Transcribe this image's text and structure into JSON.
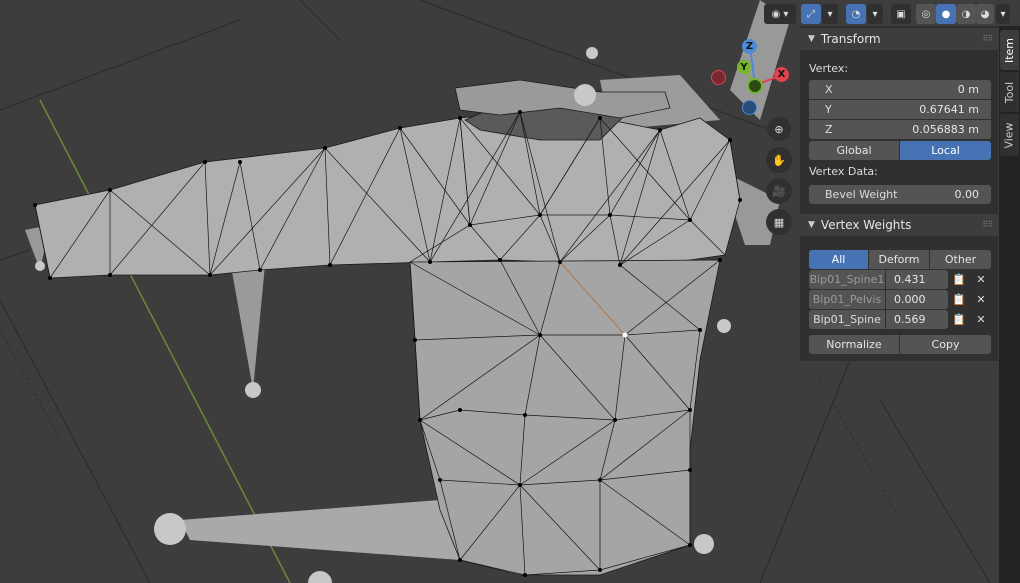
{
  "header": {
    "icons": [
      "eye-icon",
      "gizmo-icon",
      "overlay-icon",
      "xray-icon",
      "wireframe-icon",
      "solid-icon",
      "material-icon",
      "rendered-icon"
    ]
  },
  "gizmo": {
    "z": "Z",
    "y": "Y",
    "x": "X"
  },
  "transform": {
    "title": "Transform",
    "vertex_label": "Vertex:",
    "x_label": "X",
    "x_value": "0 m",
    "y_label": "Y",
    "y_value": "0.67641 m",
    "z_label": "Z",
    "z_value": "0.056883 m",
    "global": "Global",
    "local": "Local",
    "vertex_data_label": "Vertex Data:",
    "bevel_label": "Bevel Weight",
    "bevel_value": "0.00"
  },
  "vertex_weights": {
    "title": "Vertex Weights",
    "filters": [
      "All",
      "Deform",
      "Other"
    ],
    "rows": [
      {
        "name": "Bip01_Spine1",
        "value": "0.431"
      },
      {
        "name": "Bip01_Pelvis",
        "value": "0.000"
      },
      {
        "name": "Bip01_Spine",
        "value": "0.569"
      }
    ],
    "normalize": "Normalize",
    "copy": "Copy"
  },
  "tabs": [
    "Item",
    "Tool",
    "View"
  ],
  "colors": {
    "accent": "#4772b3",
    "panel": "#303030",
    "field": "#545454",
    "viewport": "#3d3d3d",
    "mesh": "#a8a8a8"
  }
}
